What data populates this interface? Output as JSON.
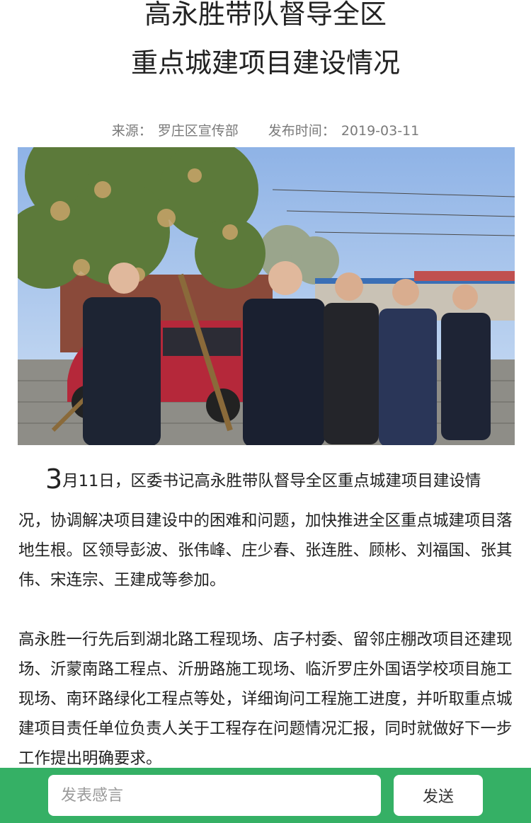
{
  "article": {
    "title_line1": "高永胜带队督导全区",
    "title_line2": "重点城建项目建设情况",
    "source_label": "来源：",
    "source_value": "罗庄区宣传部",
    "publish_label": "发布时间：",
    "publish_date": "2019-03-11",
    "para1_big": "3",
    "para1_first": "月11日，区委书记高永胜带队督导全区重点城建项目建设情",
    "para1_rest": "况，协调解决项目建设中的困难和问题，加快推进全区重点城建项目落地生根。区领导彭波、张伟峰、庄少春、张连胜、顾彬、刘福国、张其伟、宋连宗、王建成等参加。",
    "para2": "高永胜一行先后到湖北路工程现场、店子村委、留邻庄棚改项目还建现场、沂蒙南路工程点、沂册路施工现场、临沂罗庄外国语学校项目施工现场、南环路绿化工程点等处，详细询问工程施工进度，并听取重点城建项目责任单位负责人关于工程存在问题情况汇报，同时就做好下一步工作提出明确要求。"
  },
  "bottom_bar": {
    "placeholder": "发表感言",
    "send_label": "发送",
    "bar_color": "#35b065"
  }
}
